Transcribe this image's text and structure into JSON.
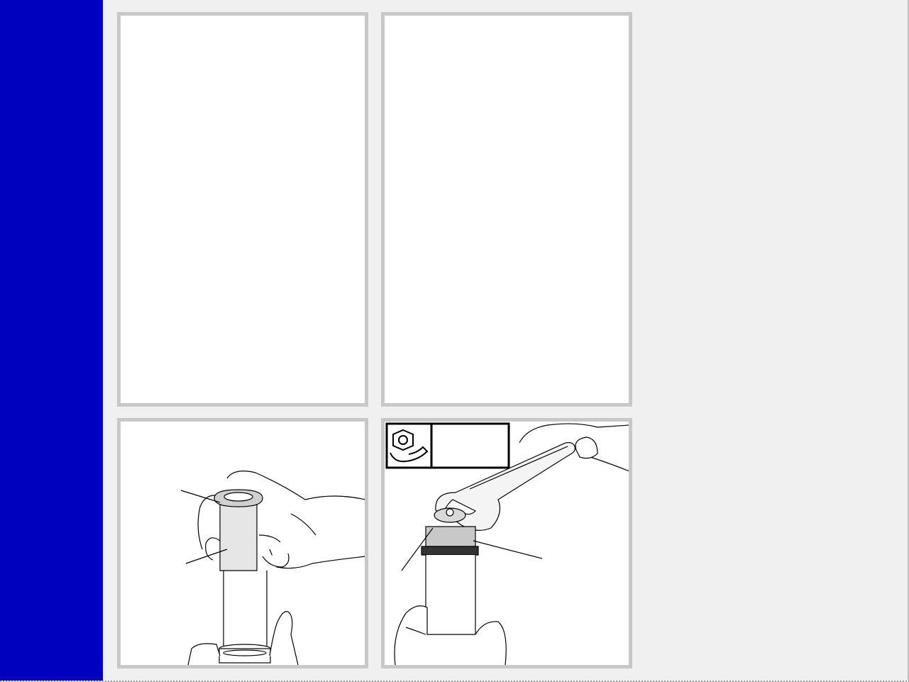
{
  "layout": {
    "sidebar_color": "#0000bf",
    "background_color": "#f0f0f0",
    "panel_border_color": "#c8c8c8"
  },
  "figures": [
    {
      "id": "top-left",
      "content": ""
    },
    {
      "id": "top-right",
      "content": ""
    },
    {
      "id": "bottom-left",
      "icons": [
        "hand-icon",
        "bushing-icon",
        "fork-tube-icon"
      ]
    },
    {
      "id": "bottom-right",
      "icons": [
        "torque-wrench-symbol-icon",
        "wrench-icon",
        "hand-icon",
        "fork-cap-icon"
      ]
    }
  ]
}
